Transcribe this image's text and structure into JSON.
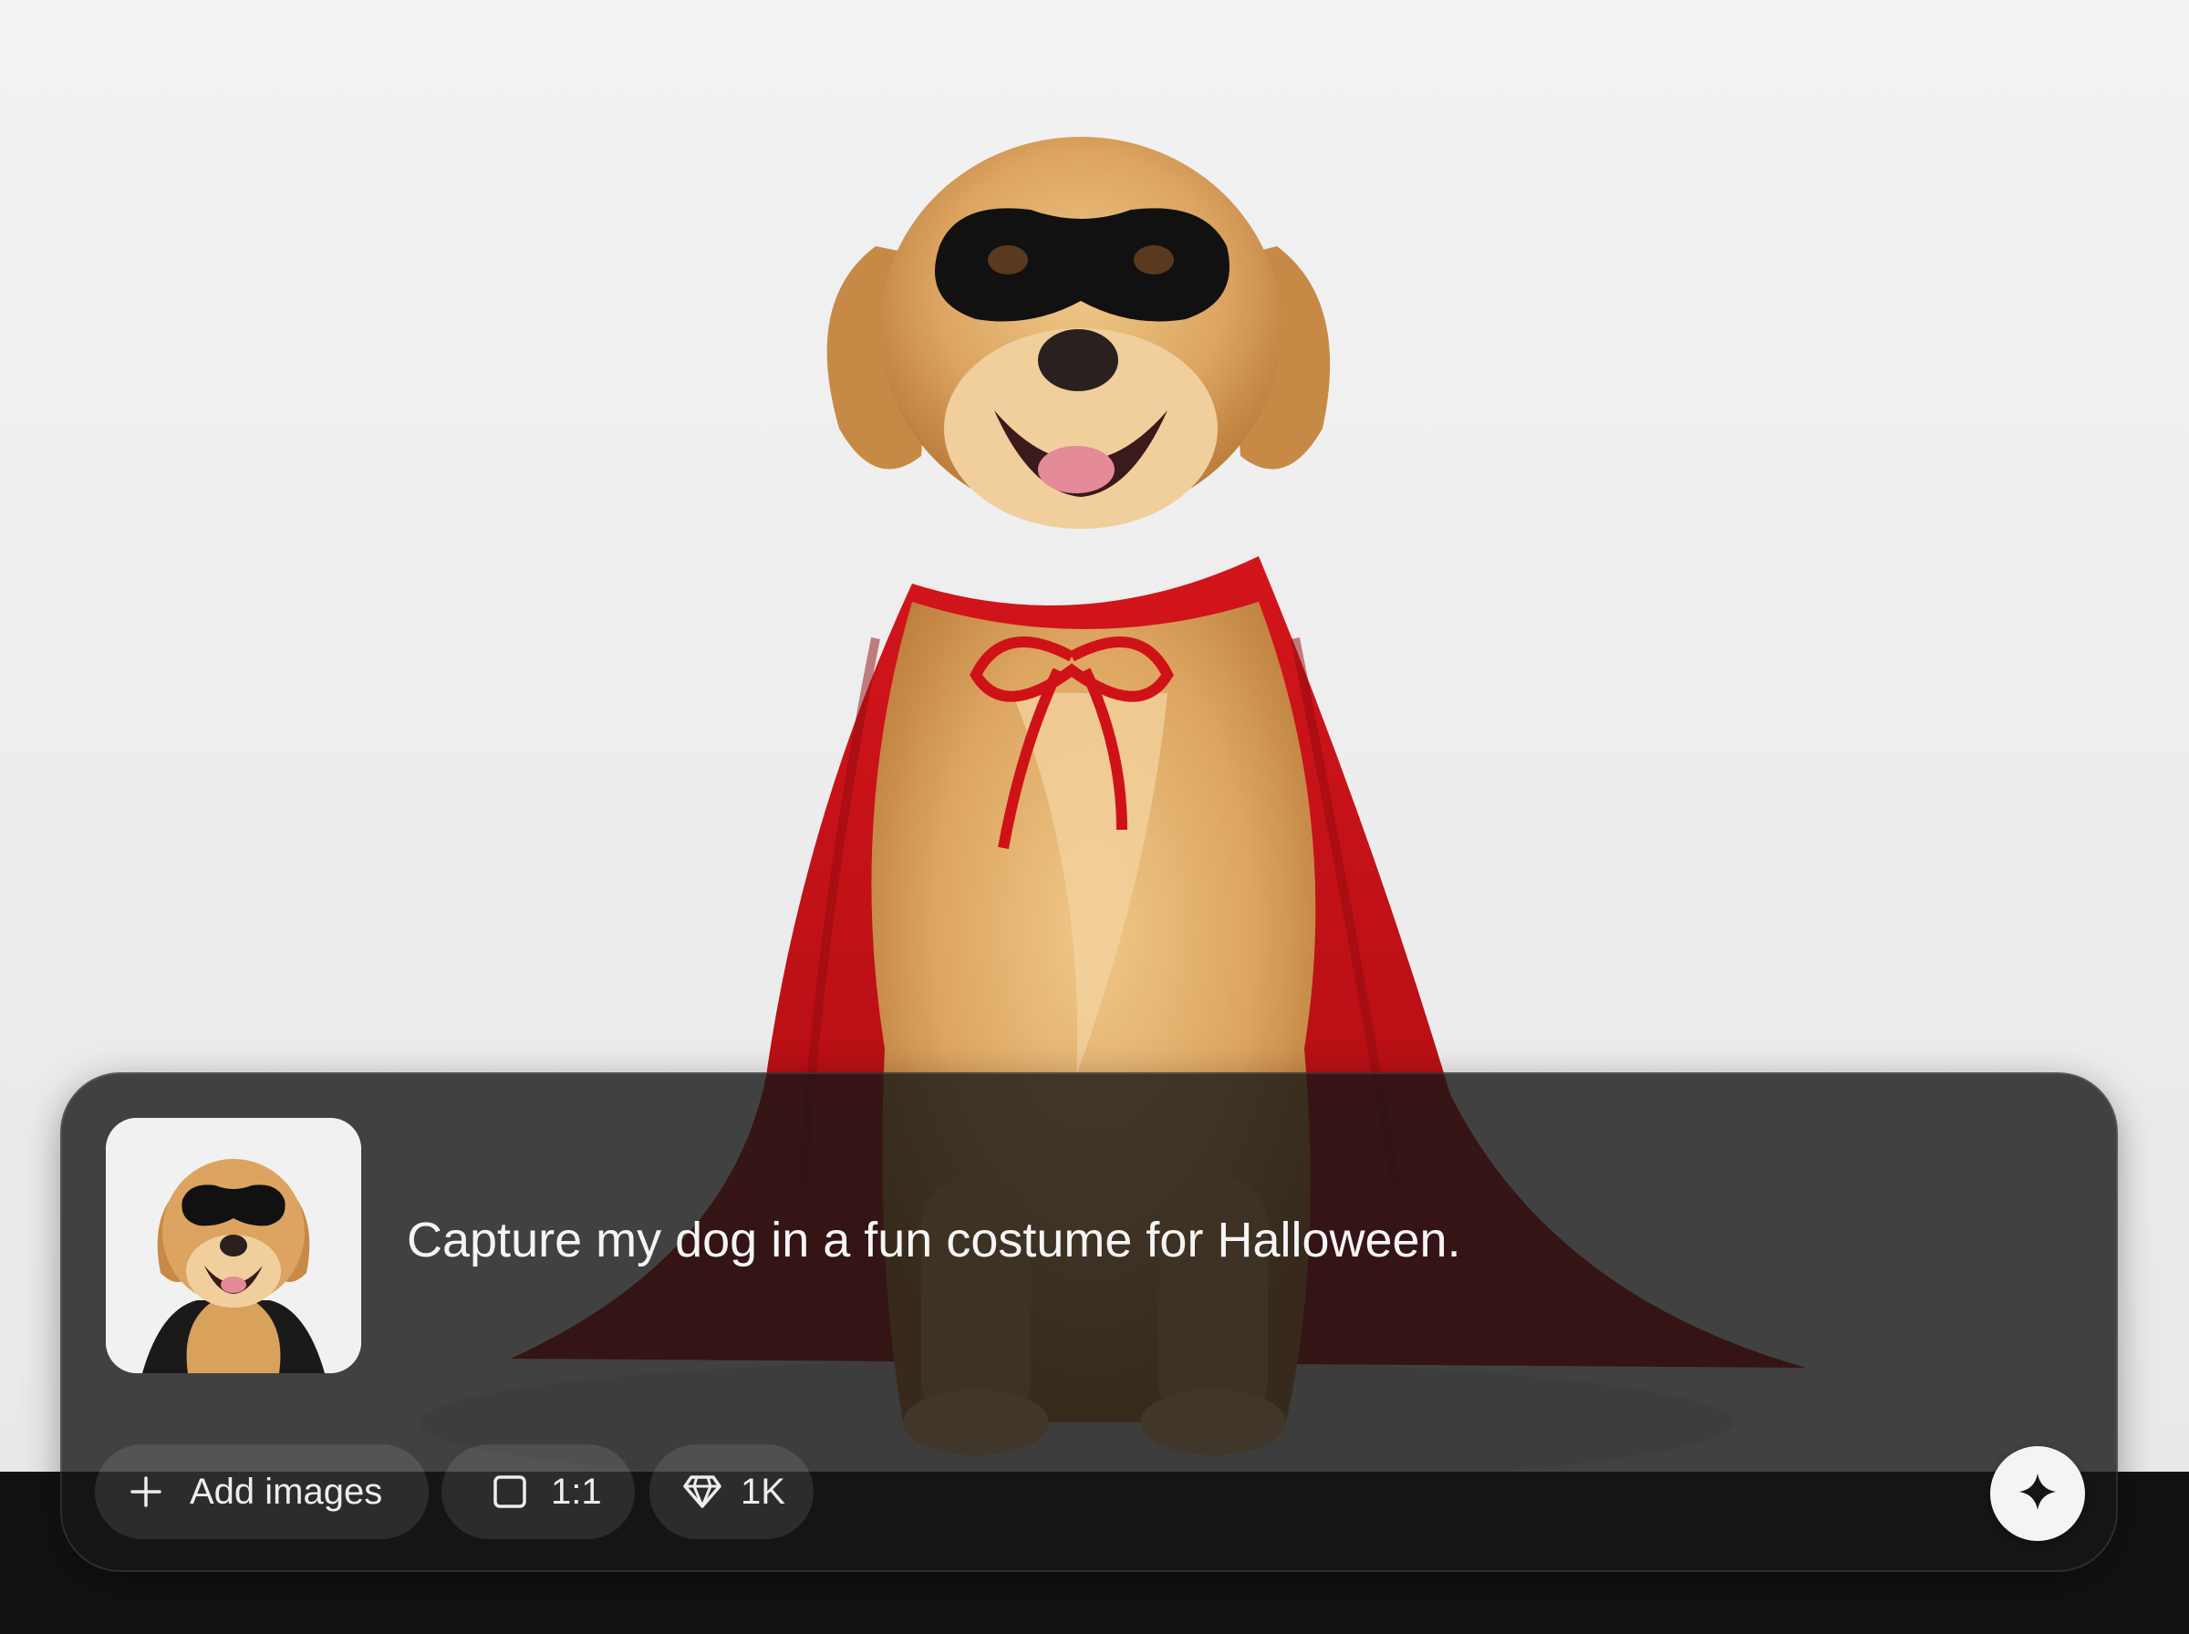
{
  "composer": {
    "prompt_text": "Capture my dog in a fun costume for Halloween.",
    "add_images_label": "Add images",
    "aspect_ratio_label": "1:1",
    "resolution_label": "1K"
  },
  "colors": {
    "panel_background": "#161616",
    "cape_red": "#c8141a",
    "fur_gold": "#d9a25c",
    "generate_button": "#f4f4f4"
  },
  "icons": {
    "add": "plus-icon",
    "aspect_ratio": "square-icon",
    "resolution": "diamond-icon",
    "generate": "sparkle-icon"
  }
}
